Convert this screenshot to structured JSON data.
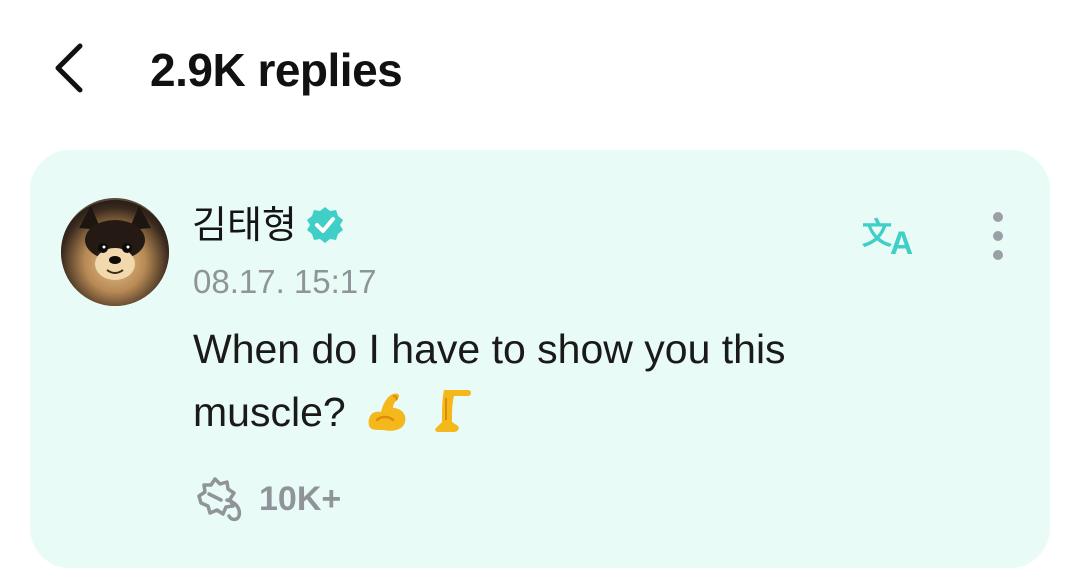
{
  "header": {
    "title": "2.9K replies",
    "back_icon": "chevron-left-icon"
  },
  "post": {
    "author_name": "김태형",
    "verified_icon": "verified-badge-icon",
    "timestamp": "08.17. 15:17",
    "message": "When do I have to show you this muscle?",
    "emojis": [
      "flexed-biceps",
      "leg"
    ],
    "translate_icon": "translate-icon",
    "more_icon": "more-vertical-icon",
    "reaction_icon": "reaction-icon",
    "reaction_count": "10K+"
  },
  "colors": {
    "card_background": "#e9fbf6",
    "accent": "#3fcfc6",
    "muted_text": "#8f9499"
  }
}
